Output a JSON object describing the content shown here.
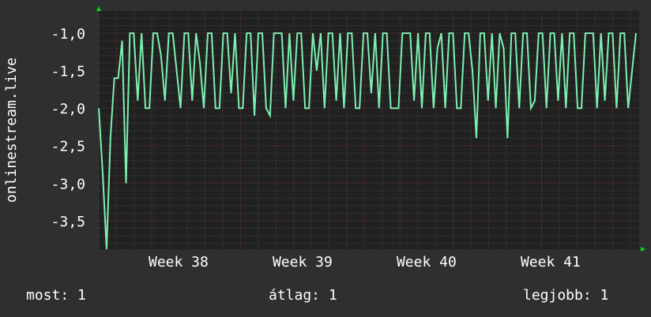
{
  "chart_data": {
    "type": "line",
    "ylabel": "onlinestream.live",
    "ylim": [
      -3.88,
      -0.705
    ],
    "xlim_days": [
      0,
      30.5
    ],
    "yticks": [
      -1.0,
      -1.5,
      -2.0,
      -2.5,
      -3.0,
      -3.5
    ],
    "ytick_labels": [
      "-1,0",
      "-1,5",
      "-2,0",
      "-2,5",
      "-3,0",
      "-3,5"
    ],
    "xtick_labels": [
      "Week 38",
      "Week 39",
      "Week 40",
      "Week 41"
    ],
    "xtick_positions_days": [
      4.5,
      11.5,
      18.5,
      25.5
    ],
    "week_boundaries_days": [
      1,
      8,
      15,
      22,
      29
    ],
    "grid": true,
    "line_color": "#7df0b0",
    "series": [
      {
        "name": "onlinestream.live",
        "values": [
          -2.0,
          -2.85,
          -3.88,
          -2.4,
          -1.6,
          -1.6,
          -1.1,
          -3.0,
          -1.0,
          -1.0,
          -1.9,
          -1.0,
          -2.0,
          -2.0,
          -1.0,
          -1.0,
          -1.3,
          -1.9,
          -1.0,
          -1.0,
          -1.5,
          -2.0,
          -1.0,
          -1.0,
          -1.9,
          -1.0,
          -1.4,
          -2.0,
          -1.0,
          -1.0,
          -2.0,
          -2.0,
          -1.0,
          -1.0,
          -1.8,
          -1.0,
          -2.0,
          -2.0,
          -1.0,
          -1.0,
          -2.1,
          -1.0,
          -1.0,
          -2.0,
          -2.1,
          -1.0,
          -1.0,
          -1.0,
          -2.0,
          -1.0,
          -1.9,
          -1.0,
          -1.0,
          -2.0,
          -2.0,
          -1.0,
          -1.5,
          -1.0,
          -2.0,
          -1.0,
          -1.0,
          -1.9,
          -1.0,
          -2.0,
          -1.0,
          -1.0,
          -2.0,
          -2.0,
          -1.0,
          -1.0,
          -1.8,
          -1.0,
          -2.0,
          -1.0,
          -1.0,
          -2.0,
          -2.0,
          -2.0,
          -1.0,
          -1.0,
          -1.0,
          -1.9,
          -1.0,
          -2.0,
          -1.0,
          -1.0,
          -2.0,
          -1.2,
          -1.0,
          -2.0,
          -1.0,
          -1.0,
          -2.0,
          -2.0,
          -1.0,
          -1.0,
          -1.5,
          -2.4,
          -1.0,
          -1.0,
          -1.9,
          -1.0,
          -2.0,
          -1.0,
          -1.2,
          -2.4,
          -1.0,
          -1.0,
          -2.0,
          -1.0,
          -1.0,
          -2.0,
          -1.9,
          -1.0,
          -1.0,
          -2.0,
          -1.0,
          -1.0,
          -1.9,
          -1.0,
          -2.0,
          -1.0,
          -1.0,
          -2.0,
          -2.0,
          -1.0,
          -1.0,
          -1.0,
          -2.0,
          -1.0,
          -1.9,
          -1.0,
          -1.0,
          -2.0,
          -1.0,
          -1.0,
          -2.0,
          -1.5,
          -1.0
        ]
      }
    ]
  },
  "legend": {
    "current": "most: 1",
    "average": "átlag: 1",
    "max": "legjobb: 1"
  }
}
